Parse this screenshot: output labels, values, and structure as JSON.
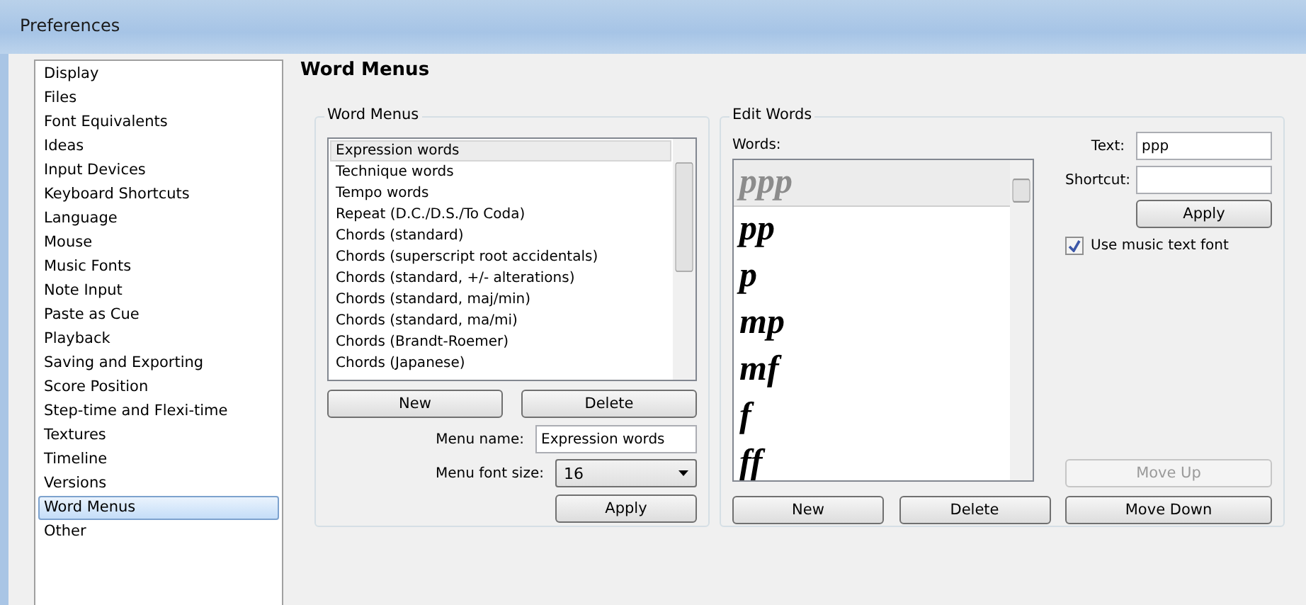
{
  "window": {
    "title": "Preferences"
  },
  "sidebar": {
    "items": [
      {
        "label": "Display",
        "selected": false
      },
      {
        "label": "Files",
        "selected": false
      },
      {
        "label": "Font Equivalents",
        "selected": false
      },
      {
        "label": "Ideas",
        "selected": false
      },
      {
        "label": "Input Devices",
        "selected": false
      },
      {
        "label": "Keyboard Shortcuts",
        "selected": false
      },
      {
        "label": "Language",
        "selected": false
      },
      {
        "label": "Mouse",
        "selected": false
      },
      {
        "label": "Music Fonts",
        "selected": false
      },
      {
        "label": "Note Input",
        "selected": false
      },
      {
        "label": "Paste as Cue",
        "selected": false
      },
      {
        "label": "Playback",
        "selected": false
      },
      {
        "label": "Saving and Exporting",
        "selected": false
      },
      {
        "label": "Score Position",
        "selected": false
      },
      {
        "label": "Step-time and Flexi-time",
        "selected": false
      },
      {
        "label": "Textures",
        "selected": false
      },
      {
        "label": "Timeline",
        "selected": false
      },
      {
        "label": "Versions",
        "selected": false
      },
      {
        "label": "Word Menus",
        "selected": true
      },
      {
        "label": "Other",
        "selected": false
      }
    ]
  },
  "page_title": "Word Menus",
  "word_menus": {
    "title": "Word Menus",
    "items": [
      {
        "label": "Expression words",
        "selected": true
      },
      {
        "label": "Technique words",
        "selected": false
      },
      {
        "label": "Tempo words",
        "selected": false
      },
      {
        "label": "Repeat (D.C./D.S./To Coda)",
        "selected": false
      },
      {
        "label": "Chords (standard)",
        "selected": false
      },
      {
        "label": "Chords (superscript root accidentals)",
        "selected": false
      },
      {
        "label": "Chords (standard, +/- alterations)",
        "selected": false
      },
      {
        "label": "Chords (standard, maj/min)",
        "selected": false
      },
      {
        "label": "Chords (standard, ma/mi)",
        "selected": false
      },
      {
        "label": "Chords (Brandt-Roemer)",
        "selected": false
      },
      {
        "label": "Chords (Japanese)",
        "selected": false
      }
    ],
    "new_button": "New",
    "delete_button": "Delete",
    "menu_name_label": "Menu name:",
    "menu_name_value": "Expression words",
    "font_size_label": "Menu font size:",
    "font_size_value": "16",
    "apply_button": "Apply"
  },
  "edit_words": {
    "title": "Edit Words",
    "words_label": "Words:",
    "words": [
      {
        "label": "ppp",
        "selected": true
      },
      {
        "label": "pp",
        "selected": false
      },
      {
        "label": "p",
        "selected": false
      },
      {
        "label": "mp",
        "selected": false
      },
      {
        "label": "mf",
        "selected": false
      },
      {
        "label": "f",
        "selected": false
      },
      {
        "label": "ff",
        "selected": false
      }
    ],
    "text_label": "Text:",
    "text_value": "ppp",
    "shortcut_label": "Shortcut:",
    "apply_button": "Apply",
    "music_font": {
      "label": "Use music text font",
      "checked": true
    },
    "move_up": {
      "label": "Move Up",
      "disabled": true
    },
    "move_down": {
      "label": "Move Down",
      "disabled": false
    },
    "new_button": "New",
    "delete_button": "Delete"
  }
}
